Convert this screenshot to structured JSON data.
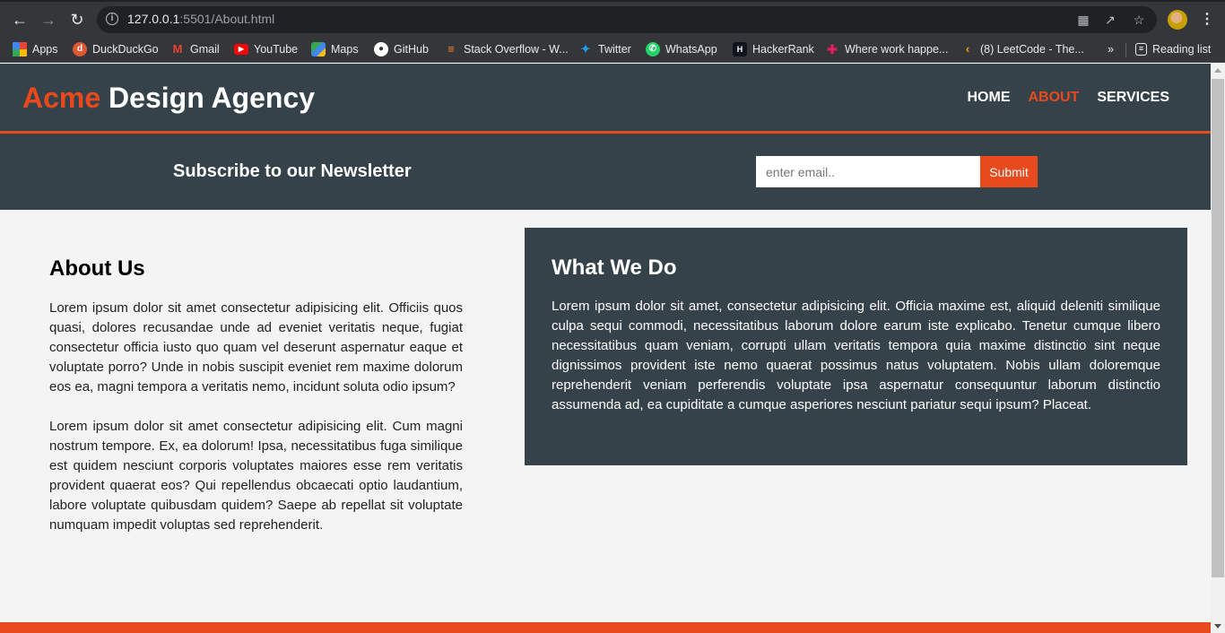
{
  "browser": {
    "url_host": "127.0.0.1",
    "url_rest": ":5501/About.html",
    "bookmarks": [
      {
        "label": "Apps",
        "icon": "apps-grid-icon",
        "color": "#e8453c"
      },
      {
        "label": "DuckDuckGo",
        "icon": "duckduckgo-icon",
        "color": "#de5833"
      },
      {
        "label": "Gmail",
        "icon": "gmail-icon",
        "color": "#ea4335"
      },
      {
        "label": "YouTube",
        "icon": "youtube-icon",
        "color": "#ff0000"
      },
      {
        "label": "Maps",
        "icon": "maps-icon",
        "color": "#34a853"
      },
      {
        "label": "GitHub",
        "icon": "github-icon",
        "color": "#ffffff"
      },
      {
        "label": "Stack Overflow - W...",
        "icon": "stackoverflow-icon",
        "color": "#f48024"
      },
      {
        "label": "Twitter",
        "icon": "twitter-icon",
        "color": "#1da1f2"
      },
      {
        "label": "WhatsApp",
        "icon": "whatsapp-icon",
        "color": "#25d366"
      },
      {
        "label": "HackerRank",
        "icon": "hackerrank-icon",
        "color": "#1ba94c"
      },
      {
        "label": "Where work happe...",
        "icon": "slack-icon",
        "color": "#e01e5a"
      },
      {
        "label": "(8) LeetCode - The...",
        "icon": "leetcode-icon",
        "color": "#ffa116"
      }
    ],
    "overflow_label": "»",
    "reading_list_label": "Reading list"
  },
  "header": {
    "brand_highlight": "Acme",
    "brand_rest": " Design Agency",
    "nav": [
      {
        "label": "Home",
        "current": false
      },
      {
        "label": "About",
        "current": true
      },
      {
        "label": "Services",
        "current": false
      }
    ]
  },
  "newsletter": {
    "title": "Subscribe to our Newsletter",
    "email_placeholder": "enter email..",
    "email_value": "",
    "submit_label": "Submit"
  },
  "main": {
    "title": "About Us",
    "paragraphs": [
      "Lorem ipsum dolor sit amet consectetur adipisicing elit. Officiis quos quasi, dolores recusandae unde ad eveniet veritatis neque, fugiat consectetur officia iusto quo quam vel deserunt aspernatur eaque et voluptate porro? Unde in nobis suscipit eveniet rem maxime dolorum eos ea, magni tempora a veritatis nemo, incidunt soluta odio ipsum?",
      "Lorem ipsum dolor sit amet consectetur adipisicing elit. Cum magni nostrum tempore. Ex, ea dolorum! Ipsa, necessitatibus fuga similique est quidem nesciunt corporis voluptates maiores esse rem veritatis provident quaerat eos? Qui repellendus obcaecati optio laudantium, labore voluptate quibusdam quidem? Saepe ab repellat sit voluptate numquam impedit voluptas sed reprehenderit."
    ]
  },
  "sidebar": {
    "title": "What We Do",
    "paragraph": "Lorem ipsum dolor sit amet, consectetur adipisicing elit. Officia maxime est, aliquid deleniti similique culpa sequi commodi, necessitatibus laborum dolore earum iste explicabo. Tenetur cumque libero necessitatibus quam veniam, corrupti ullam veritatis tempora quia maxime distinctio sint neque dignissimos provident iste nemo quaerat possimus natus voluptatem. Nobis ullam doloremque reprehenderit veniam perferendis voluptate ipsa aspernatur consequuntur laborum distinctio assumenda ad, ea cupiditate a cumque asperiores nesciunt pariatur sequi ipsum? Placeat."
  },
  "colors": {
    "accent": "#e8491d",
    "dark": "#35424a",
    "background": "#f4f4f4"
  }
}
